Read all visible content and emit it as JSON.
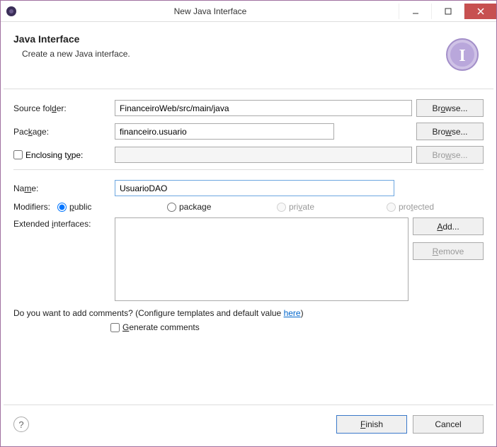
{
  "window": {
    "title": "New Java Interface"
  },
  "banner": {
    "title": "Java Interface",
    "subtitle": "Create a new Java interface."
  },
  "labels": {
    "source_folder": "Source folder:",
    "package": "Package:",
    "enclosing_type": "Enclosing type:",
    "name": "Name:",
    "modifiers": "Modifiers:",
    "extended_interfaces": "Extended interfaces:",
    "comments_question": "Do you want to add comments? (Configure templates and default value ",
    "comments_link": "here",
    "comments_close": ")",
    "generate_comments": "Generate comments"
  },
  "fields": {
    "source_folder": "FinanceiroWeb/src/main/java",
    "package": "financeiro.usuario",
    "enclosing_type": "",
    "name": "UsuarioDAO"
  },
  "modifiers": {
    "public": "public",
    "package": "package",
    "private": "private",
    "protected": "protected",
    "selected": "public"
  },
  "buttons": {
    "browse": "Browse...",
    "add": "Add...",
    "remove": "Remove",
    "finish": "Finish",
    "cancel": "Cancel"
  }
}
